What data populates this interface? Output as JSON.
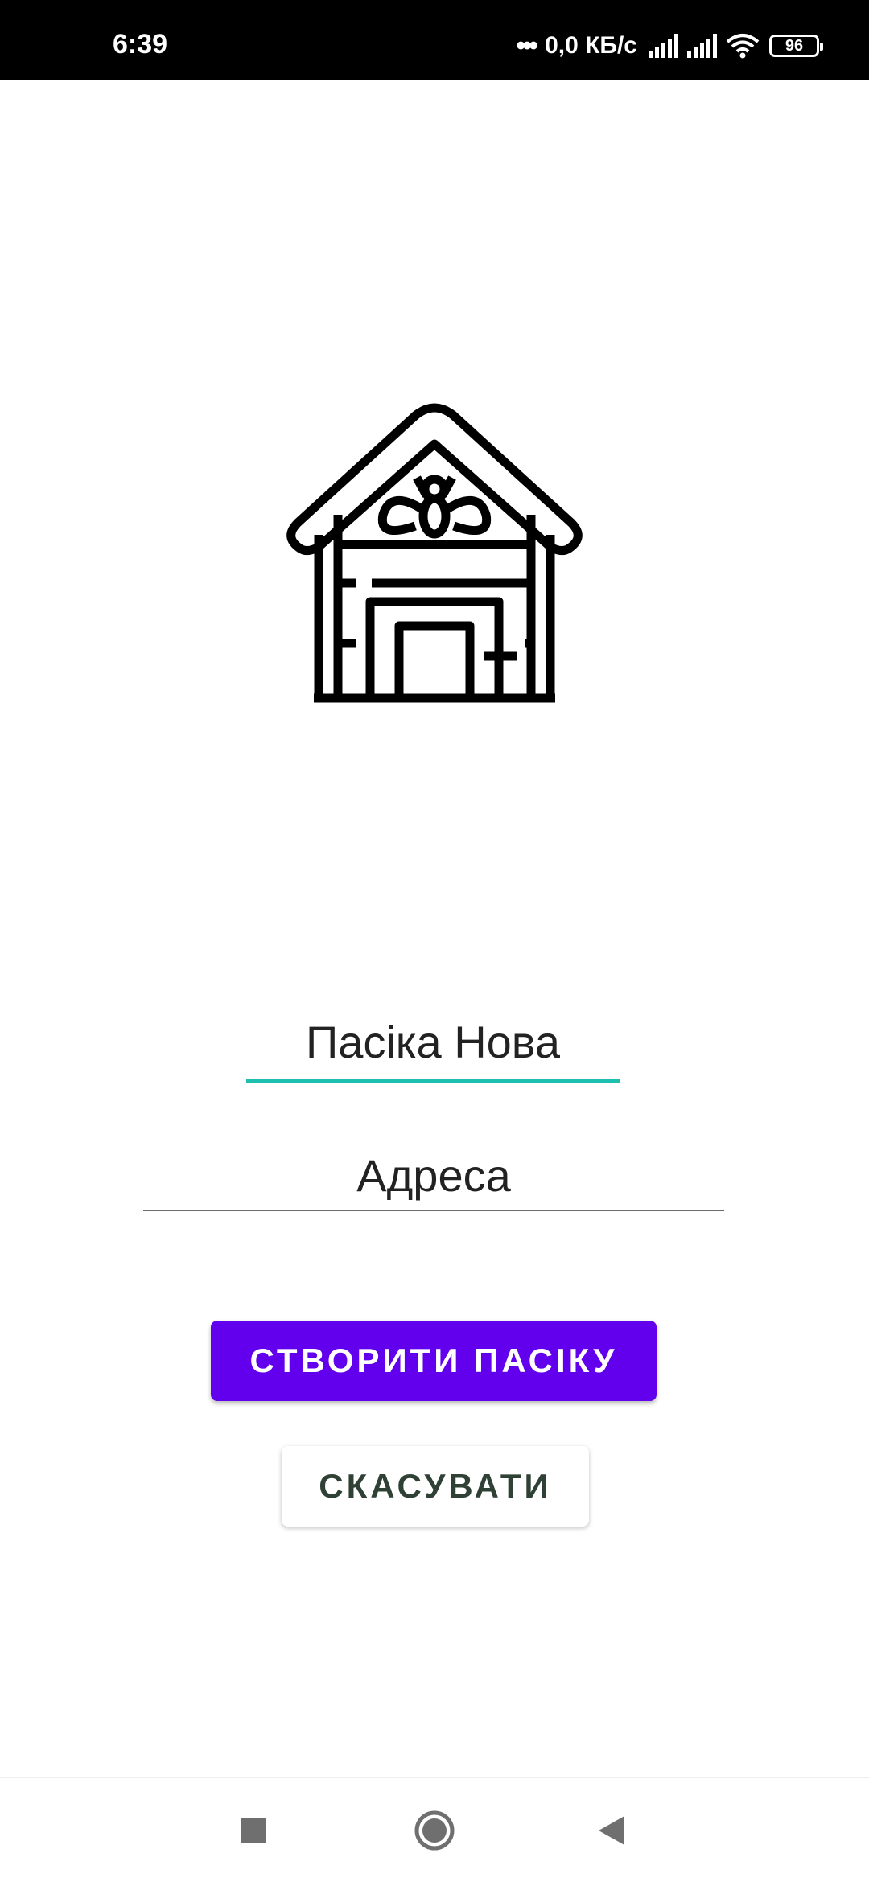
{
  "status_bar": {
    "time": "6:39",
    "dots": "•••",
    "network_speed": "0,0 КБ/с",
    "battery_level": "96",
    "icons": [
      "signal-icon",
      "signal-icon",
      "wifi-icon",
      "battery-icon"
    ]
  },
  "logo": {
    "icon": "beehive-icon"
  },
  "form": {
    "name_value": "Пасіка Нова",
    "address_placeholder": "Адреса",
    "create_button_label": "СТВОРИТИ ПАСІКУ",
    "cancel_button_label": "СКАСУВАТИ"
  },
  "navigation": {
    "icons": [
      "recents-icon",
      "home-icon",
      "back-icon"
    ]
  },
  "colors": {
    "primary": "#6200ee",
    "field_focus_underline": "#1fbfb0",
    "cancel_text": "#2f4034",
    "status_bar": "#000000"
  }
}
